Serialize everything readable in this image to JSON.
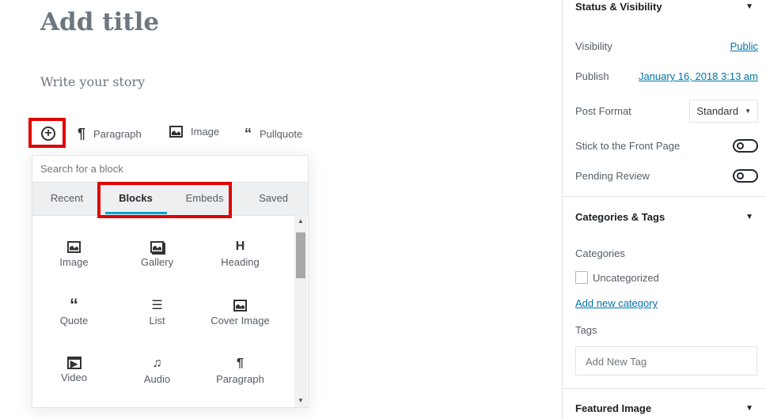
{
  "editor": {
    "title_placeholder": "Add title",
    "story_placeholder": "Write your story",
    "quick_inserts": [
      {
        "icon": "paragraph-icon",
        "label": "Paragraph"
      },
      {
        "icon": "image-icon",
        "label": "Image"
      },
      {
        "icon": "quote-icon",
        "label": "Pullquote"
      }
    ]
  },
  "inserter": {
    "search_placeholder": "Search for a block",
    "tabs": [
      {
        "label": "Recent",
        "active": false
      },
      {
        "label": "Blocks",
        "active": true
      },
      {
        "label": "Embeds",
        "active": false
      },
      {
        "label": "Saved",
        "active": false
      }
    ],
    "blocks": [
      {
        "icon": "image-icon",
        "label": "Image"
      },
      {
        "icon": "gallery-icon",
        "label": "Gallery"
      },
      {
        "icon": "heading-icon",
        "label": "Heading"
      },
      {
        "icon": "quote-icon",
        "label": "Quote"
      },
      {
        "icon": "list-icon",
        "label": "List"
      },
      {
        "icon": "cover-image-icon",
        "label": "Cover Image"
      },
      {
        "icon": "video-icon",
        "label": "Video"
      },
      {
        "icon": "audio-icon",
        "label": "Audio"
      },
      {
        "icon": "paragraph-icon",
        "label": "Paragraph"
      }
    ],
    "highlight_color": "#e00000",
    "active_tab_color": "#00a0d2"
  },
  "sidebar": {
    "status": {
      "title": "Status & Visibility",
      "visibility_label": "Visibility",
      "visibility_value": "Public",
      "publish_label": "Publish",
      "publish_value": "January 16, 2018 3:13 am",
      "post_format_label": "Post Format",
      "post_format_value": "Standard",
      "sticky_label": "Stick to the Front Page",
      "sticky_on": false,
      "pending_label": "Pending Review",
      "pending_on": false
    },
    "categories": {
      "title": "Categories & Tags",
      "categories_label": "Categories",
      "category_item": "Uncategorized",
      "category_checked": false,
      "add_category": "Add new category",
      "tags_label": "Tags",
      "tag_placeholder": "Add New Tag"
    },
    "featured": {
      "title": "Featured Image"
    }
  }
}
